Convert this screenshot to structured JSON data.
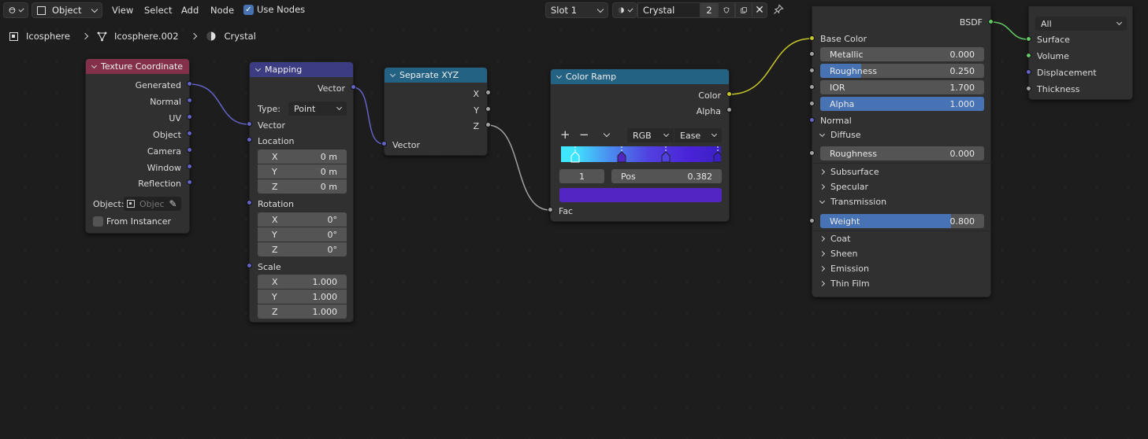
{
  "topbar": {
    "editor_type_icon": "node-editor-icon",
    "object_mode": "Object",
    "menus": [
      "View",
      "Select",
      "Add",
      "Node"
    ],
    "use_nodes_label": "Use Nodes",
    "use_nodes_checked": true,
    "slot": "Slot 1",
    "material_name": "Crystal",
    "user_count": "2"
  },
  "breadcrumb": {
    "object": "Icosphere",
    "mesh": "Icosphere.002",
    "material": "Crystal"
  },
  "nodes": {
    "texcoord": {
      "title": "Texture Coordinate",
      "outputs": [
        "Generated",
        "Normal",
        "UV",
        "Object",
        "Camera",
        "Window",
        "Reflection"
      ],
      "object_label": "Object:",
      "object_placeholder": "Objec",
      "from_instancer": "From Instancer"
    },
    "mapping": {
      "title": "Mapping",
      "output": "Vector",
      "type_label": "Type:",
      "type_value": "Point",
      "vector_input": "Vector",
      "location": "Location",
      "loc": [
        {
          "axis": "X",
          "val": "0 m"
        },
        {
          "axis": "Y",
          "val": "0 m"
        },
        {
          "axis": "Z",
          "val": "0 m"
        }
      ],
      "rotation": "Rotation",
      "rot": [
        {
          "axis": "X",
          "val": "0°"
        },
        {
          "axis": "Y",
          "val": "0°"
        },
        {
          "axis": "Z",
          "val": "0°"
        }
      ],
      "scale": "Scale",
      "scl": [
        {
          "axis": "X",
          "val": "1.000"
        },
        {
          "axis": "Y",
          "val": "1.000"
        },
        {
          "axis": "Z",
          "val": "1.000"
        }
      ]
    },
    "separate": {
      "title": "Separate XYZ",
      "outputs": [
        "X",
        "Y",
        "Z"
      ],
      "input": "Vector"
    },
    "colorramp": {
      "title": "Color Ramp",
      "outputs": [
        "Color",
        "Alpha"
      ],
      "color_mode": "RGB",
      "interpolation": "Ease",
      "active_index": "1",
      "pos_label": "Pos",
      "pos_value": "0.382",
      "input": "Fac",
      "active_color": "#5325c2"
    },
    "bsdf": {
      "output": "BSDF",
      "base_color": "Base Color",
      "metallic": {
        "label": "Metallic",
        "value": "0.000"
      },
      "roughness": {
        "label": "Roughness",
        "value": "0.250",
        "fill": 0.25
      },
      "ior": {
        "label": "IOR",
        "value": "1.700"
      },
      "alpha": {
        "label": "Alpha",
        "value": "1.000",
        "fill": 1.0
      },
      "normal": "Normal",
      "diffuse": "Diffuse",
      "diffuse_roughness": {
        "label": "Roughness",
        "value": "0.000"
      },
      "subsurface": "Subsurface",
      "specular": "Specular",
      "transmission": "Transmission",
      "weight": {
        "label": "Weight",
        "value": "0.800",
        "fill": 0.8
      },
      "coat": "Coat",
      "sheen": "Sheen",
      "emission": "Emission",
      "thin_film": "Thin Film"
    },
    "output": {
      "target": "All",
      "inputs": [
        "Surface",
        "Volume",
        "Displacement",
        "Thickness"
      ]
    }
  },
  "colors": {
    "header_input": "#83314a",
    "header_vector": "#3c3c83",
    "header_converter": "#246283",
    "link_vector": "#6363c7",
    "link_float": "#a1a1a1",
    "link_color": "#c7c729",
    "link_shader": "#63c763"
  }
}
